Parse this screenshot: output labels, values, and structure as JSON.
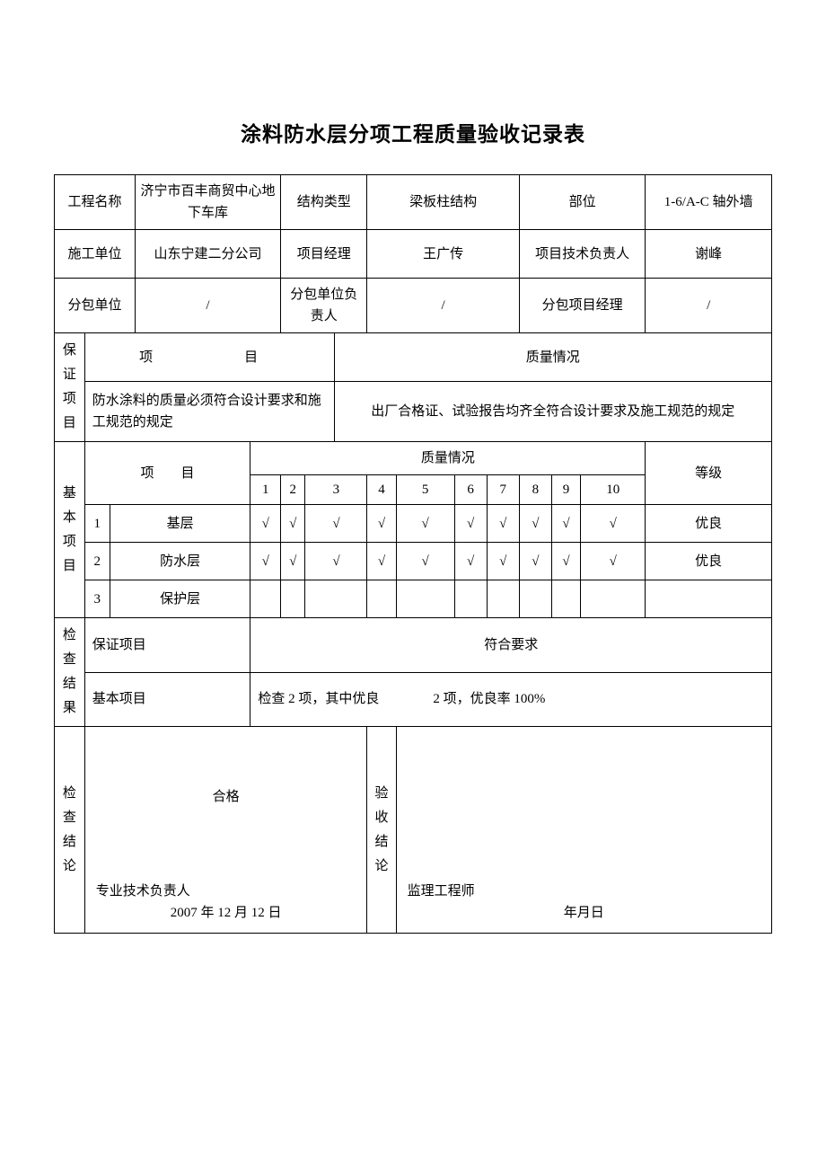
{
  "title": "涂料防水层分项工程质量验收记录表",
  "header": {
    "projectNameLabel": "工程名称",
    "projectName": "济宁市百丰商贸中心地下车库",
    "structTypeLabel": "结构类型",
    "structType": "梁板柱结构",
    "partLabel": "部位",
    "part": "1-6/A-C 轴外墙",
    "constructorLabel": "施工单位",
    "constructor": "山东宁建二分公司",
    "pmLabel": "项目经理",
    "pm": "王广传",
    "techLeadLabel": "项目技术负责人",
    "techLead": "谢峰",
    "subUnitLabel": "分包单位",
    "subUnit": "/",
    "subLeadLabel": "分包单位负责人",
    "subLead": "/",
    "subPmLabel": "分包项目经理",
    "subPm": "/"
  },
  "guarantee": {
    "sectionLabel": "保 证项目",
    "itemHeader": "项　　目",
    "qualityHeader": "质量情况",
    "itemText": "防水涂料的质量必须符合设计要求和施工规范的规定",
    "qualityText": "出厂合格证、试验报告均齐全符合设计要求及施工规范的规定"
  },
  "basic": {
    "sectionLabel": "基 本项目",
    "itemHeader": "项　　目",
    "qualityHeader": "质量情况",
    "gradeHeader": "等级",
    "cols": [
      "1",
      "2",
      "3",
      "4",
      "5",
      "6",
      "7",
      "8",
      "9",
      "10"
    ],
    "rows": [
      {
        "no": "1",
        "name": "基层",
        "vals": [
          "√",
          "√",
          "√",
          "√",
          "√",
          "√",
          "√",
          "√",
          "√",
          "√"
        ],
        "grade": "优良"
      },
      {
        "no": "2",
        "name": "防水层",
        "vals": [
          "√",
          "√",
          "√",
          "√",
          "√",
          "√",
          "√",
          "√",
          "√",
          "√"
        ],
        "grade": "优良"
      },
      {
        "no": "3",
        "name": "保护层",
        "vals": [
          "",
          "",
          "",
          "",
          "",
          "",
          "",
          "",
          "",
          ""
        ],
        "grade": ""
      }
    ]
  },
  "check": {
    "sectionLabel": "检 查结果",
    "guaranteeLabel": "保证项目",
    "guaranteeResult": "符合要求",
    "basicLabel": "基本项目",
    "basicResult": "检查 2 项，其中优良　　　　2 项，优良率 100%"
  },
  "conclusion": {
    "leftLabel": "检 查结论",
    "leftTop": "合格",
    "leftMid": "专业技术负责人",
    "leftBot": "2007 年 12 月 12 日",
    "rightLabel": "验 收结 论",
    "rightMid": "监理工程师",
    "rightBot": "年月日"
  }
}
